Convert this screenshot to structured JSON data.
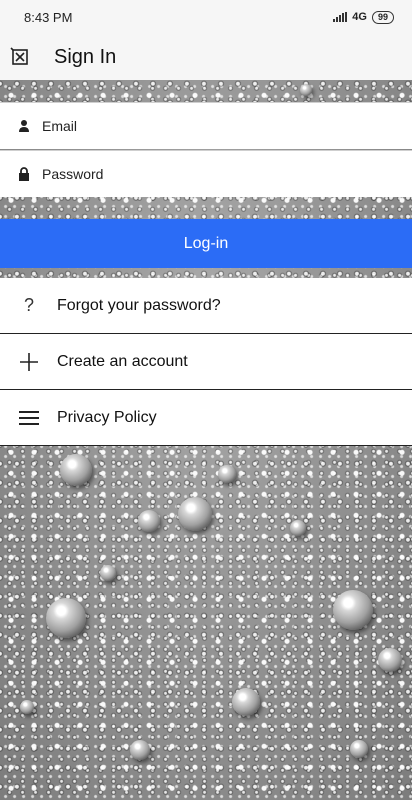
{
  "status_bar": {
    "time": "8:43 PM",
    "network": "4G",
    "battery": "99"
  },
  "app_bar": {
    "title": "Sign In",
    "close_icon": "close-icon"
  },
  "form": {
    "email_placeholder": "Email",
    "password_placeholder": "Password",
    "login_label": "Log-in"
  },
  "menu": {
    "items": [
      {
        "label": "Forgot your password?",
        "icon": "question-icon"
      },
      {
        "label": "Create an account",
        "icon": "plus-icon"
      },
      {
        "label": "Privacy Policy",
        "icon": "menu-icon"
      }
    ]
  },
  "colors": {
    "accent": "#2b6cf6",
    "bar": "#f6f6f6"
  }
}
